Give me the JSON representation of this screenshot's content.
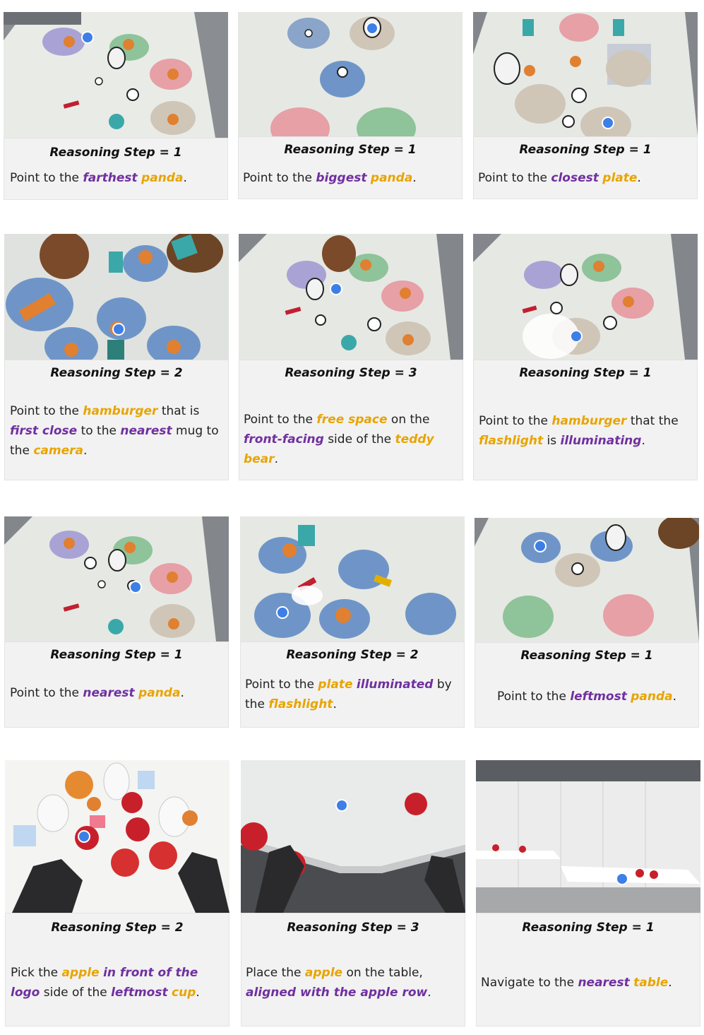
{
  "cards": [
    {
      "step": "Reasoning Step = 1",
      "segs": [
        [
          "Point to the ",
          ""
        ],
        [
          "farthest",
          "p"
        ],
        [
          " ",
          ""
        ],
        [
          "panda",
          "y"
        ],
        [
          ".",
          ""
        ]
      ]
    },
    {
      "step": "Reasoning Step = 1",
      "segs": [
        [
          "Point to the ",
          ""
        ],
        [
          "biggest",
          "p"
        ],
        [
          " ",
          ""
        ],
        [
          "panda",
          "y"
        ],
        [
          ".",
          ""
        ]
      ]
    },
    {
      "step": "Reasoning Step = 1",
      "segs": [
        [
          "Point to the ",
          ""
        ],
        [
          "closest",
          "p"
        ],
        [
          " ",
          ""
        ],
        [
          "plate",
          "y"
        ],
        [
          ".",
          ""
        ]
      ]
    },
    {
      "step": "Reasoning Step = 2",
      "segs": [
        [
          "Point to the ",
          ""
        ],
        [
          "hamburger",
          "y"
        ],
        [
          " that is ",
          ""
        ],
        [
          "first close",
          "p"
        ],
        [
          " to the ",
          ""
        ],
        [
          "nearest",
          "p"
        ],
        [
          " mug to the ",
          ""
        ],
        [
          "camera",
          "y"
        ],
        [
          ".",
          ""
        ]
      ]
    },
    {
      "step": "Reasoning Step = 3",
      "segs": [
        [
          "Point to the ",
          ""
        ],
        [
          "free space",
          "y"
        ],
        [
          " on the ",
          ""
        ],
        [
          "front-facing",
          "p"
        ],
        [
          " side of the ",
          ""
        ],
        [
          "teddy bear",
          "y"
        ],
        [
          ".",
          ""
        ]
      ]
    },
    {
      "step": "Reasoning Step = 1",
      "segs": [
        [
          "Point to the ",
          ""
        ],
        [
          "hamburger",
          "y"
        ],
        [
          " that the ",
          ""
        ],
        [
          "flashlight",
          "y"
        ],
        [
          " is ",
          ""
        ],
        [
          "illuminating",
          "p"
        ],
        [
          ".",
          ""
        ]
      ]
    },
    {
      "step": "Reasoning Step = 1",
      "segs": [
        [
          "Point to the ",
          ""
        ],
        [
          "nearest",
          "p"
        ],
        [
          " ",
          ""
        ],
        [
          "panda",
          "y"
        ],
        [
          ".",
          ""
        ]
      ]
    },
    {
      "step": "Reasoning Step = 2",
      "segs": [
        [
          "Point to the ",
          ""
        ],
        [
          "plate",
          "y"
        ],
        [
          " ",
          ""
        ],
        [
          "illuminated",
          "p"
        ],
        [
          " by the ",
          ""
        ],
        [
          "flashlight",
          "y"
        ],
        [
          ".",
          ""
        ]
      ]
    },
    {
      "step": "Reasoning Step = 1",
      "segs": [
        [
          "Point to the ",
          ""
        ],
        [
          "leftmost",
          "p"
        ],
        [
          " ",
          ""
        ],
        [
          "panda",
          "y"
        ],
        [
          ".",
          ""
        ]
      ]
    },
    {
      "step": "Reasoning Step = 2",
      "segs": [
        [
          "Pick the ",
          ""
        ],
        [
          "apple",
          "y"
        ],
        [
          " ",
          ""
        ],
        [
          "in front of the logo",
          "p"
        ],
        [
          " side of the ",
          ""
        ],
        [
          "leftmost",
          "p"
        ],
        [
          " ",
          ""
        ],
        [
          "cup",
          "y"
        ],
        [
          ".",
          ""
        ]
      ]
    },
    {
      "step": "Reasoning Step = 3",
      "segs": [
        [
          "Place the ",
          ""
        ],
        [
          "apple",
          "y"
        ],
        [
          " on the table, ",
          ""
        ],
        [
          "aligned with the apple row",
          "p"
        ],
        [
          ".",
          ""
        ]
      ]
    },
    {
      "step": "Reasoning Step = 1",
      "segs": [
        [
          "Navigate to the ",
          ""
        ],
        [
          "nearest",
          "p"
        ],
        [
          " ",
          ""
        ],
        [
          "table",
          "y"
        ],
        [
          ".",
          ""
        ]
      ]
    }
  ]
}
